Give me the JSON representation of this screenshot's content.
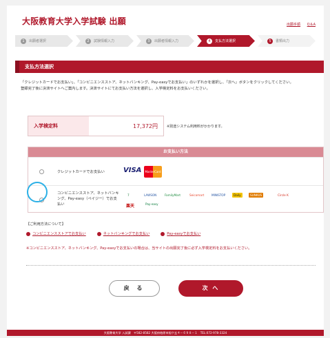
{
  "header": {
    "title": "大阪教育大学入学試験 出願",
    "links": [
      "出願手順",
      "Q＆A"
    ]
  },
  "steps": [
    {
      "num": "1",
      "label": "出願者選択"
    },
    {
      "num": "2",
      "label": "試験情報入力"
    },
    {
      "num": "3",
      "label": "出願者情報入力"
    },
    {
      "num": "4",
      "label": "支払方法選択"
    },
    {
      "num": "5",
      "label": "書類出力"
    }
  ],
  "section_title": "支払方法選択",
  "intro": {
    "line1": "「クレジットカードでお支払い」、「コンビニエンスストア、ネットバンキング、Pay-easyでお支払い」のいずれかを選択し、「次へ」ボタンをクリックしてください。",
    "line2": "登録完了後に決済サイトへご案内します。決済サイトにてお支払い方法を選択し、入学検定料をお支払いください。"
  },
  "fee": {
    "label": "入学検定料",
    "value": "17,372円",
    "note": "※別途システム利用料がかかります。"
  },
  "methods": {
    "header": "お支払い方法",
    "credit_label": "クレジットカードでお支払い",
    "visa": "VISA",
    "mastercard": "MasterCard",
    "cvs_label": "コンビニエンスストア、ネットバンキング、Pay-easy（ペイジー）でお支払い",
    "cvs_logos": [
      "7",
      "LAWSON",
      "FamilyMart",
      "Seicomart",
      "MINISTOP",
      "Daily",
      "SUNKUS",
      "Circle K"
    ],
    "pay_logos": [
      "楽天",
      "Pay-easy"
    ]
  },
  "notes": {
    "title": "【ご利用方法について】",
    "links": [
      "コンビニエンスストアでお支払い",
      "ネットバンキングでお支払い",
      "Pay-easyでお支払い"
    ],
    "warning": "※コンビニエンスストア、ネットバンキング、Pay-easyでお支払いの場合は、当サイトの出願完了後に必ず入学検定料をお支払いください。"
  },
  "buttons": {
    "back": "戻 る",
    "next": "次 へ"
  },
  "footer": "大阪教育大学 入試課　〒582-8582 大阪府柏原市旭ケ丘４－６９８－１　TEL:072-978-3324",
  "colors": {
    "brand": "#b0182b",
    "highlight": "#2bb0e6"
  }
}
